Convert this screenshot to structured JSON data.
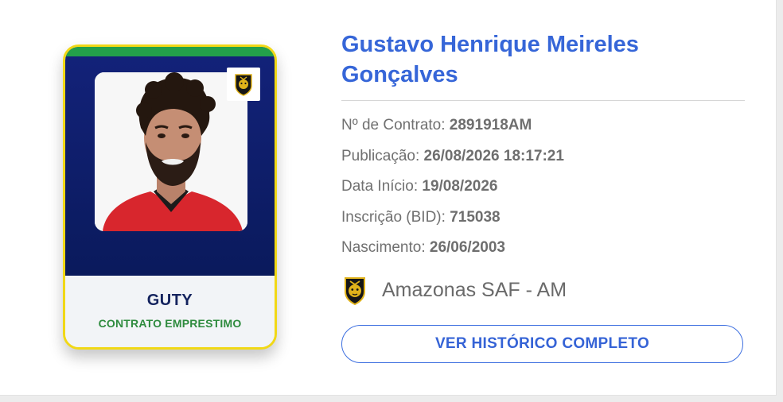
{
  "player": {
    "full_name": "Gustavo Henrique Meireles Gonçalves",
    "nickname": "GUTY",
    "contract_type": "CONTRATO EMPRESTIMO",
    "photo_icon": "player-photo",
    "club_badge_icon": "club-crest-icon"
  },
  "details": [
    {
      "label": "Nº de Contrato: ",
      "value": "2891918AM"
    },
    {
      "label": "Publicação: ",
      "value": "26/08/2026 18:17:21"
    },
    {
      "label": "Data Início: ",
      "value": "19/08/2026"
    },
    {
      "label": "Inscrição (BID): ",
      "value": "715038"
    },
    {
      "label": "Nascimento: ",
      "value": "26/06/2003"
    }
  ],
  "club": {
    "name": "Amazonas SAF - AM"
  },
  "actions": {
    "history_label": "VER HISTÓRICO COMPLETO"
  },
  "colors": {
    "card_border": "#f1d816",
    "card_top_stripe": "#23a04a",
    "card_background": "#0d1f66",
    "name_blue": "#3666d8",
    "contract_green": "#2e8b3e",
    "button_blue": "#3d6fe0"
  }
}
